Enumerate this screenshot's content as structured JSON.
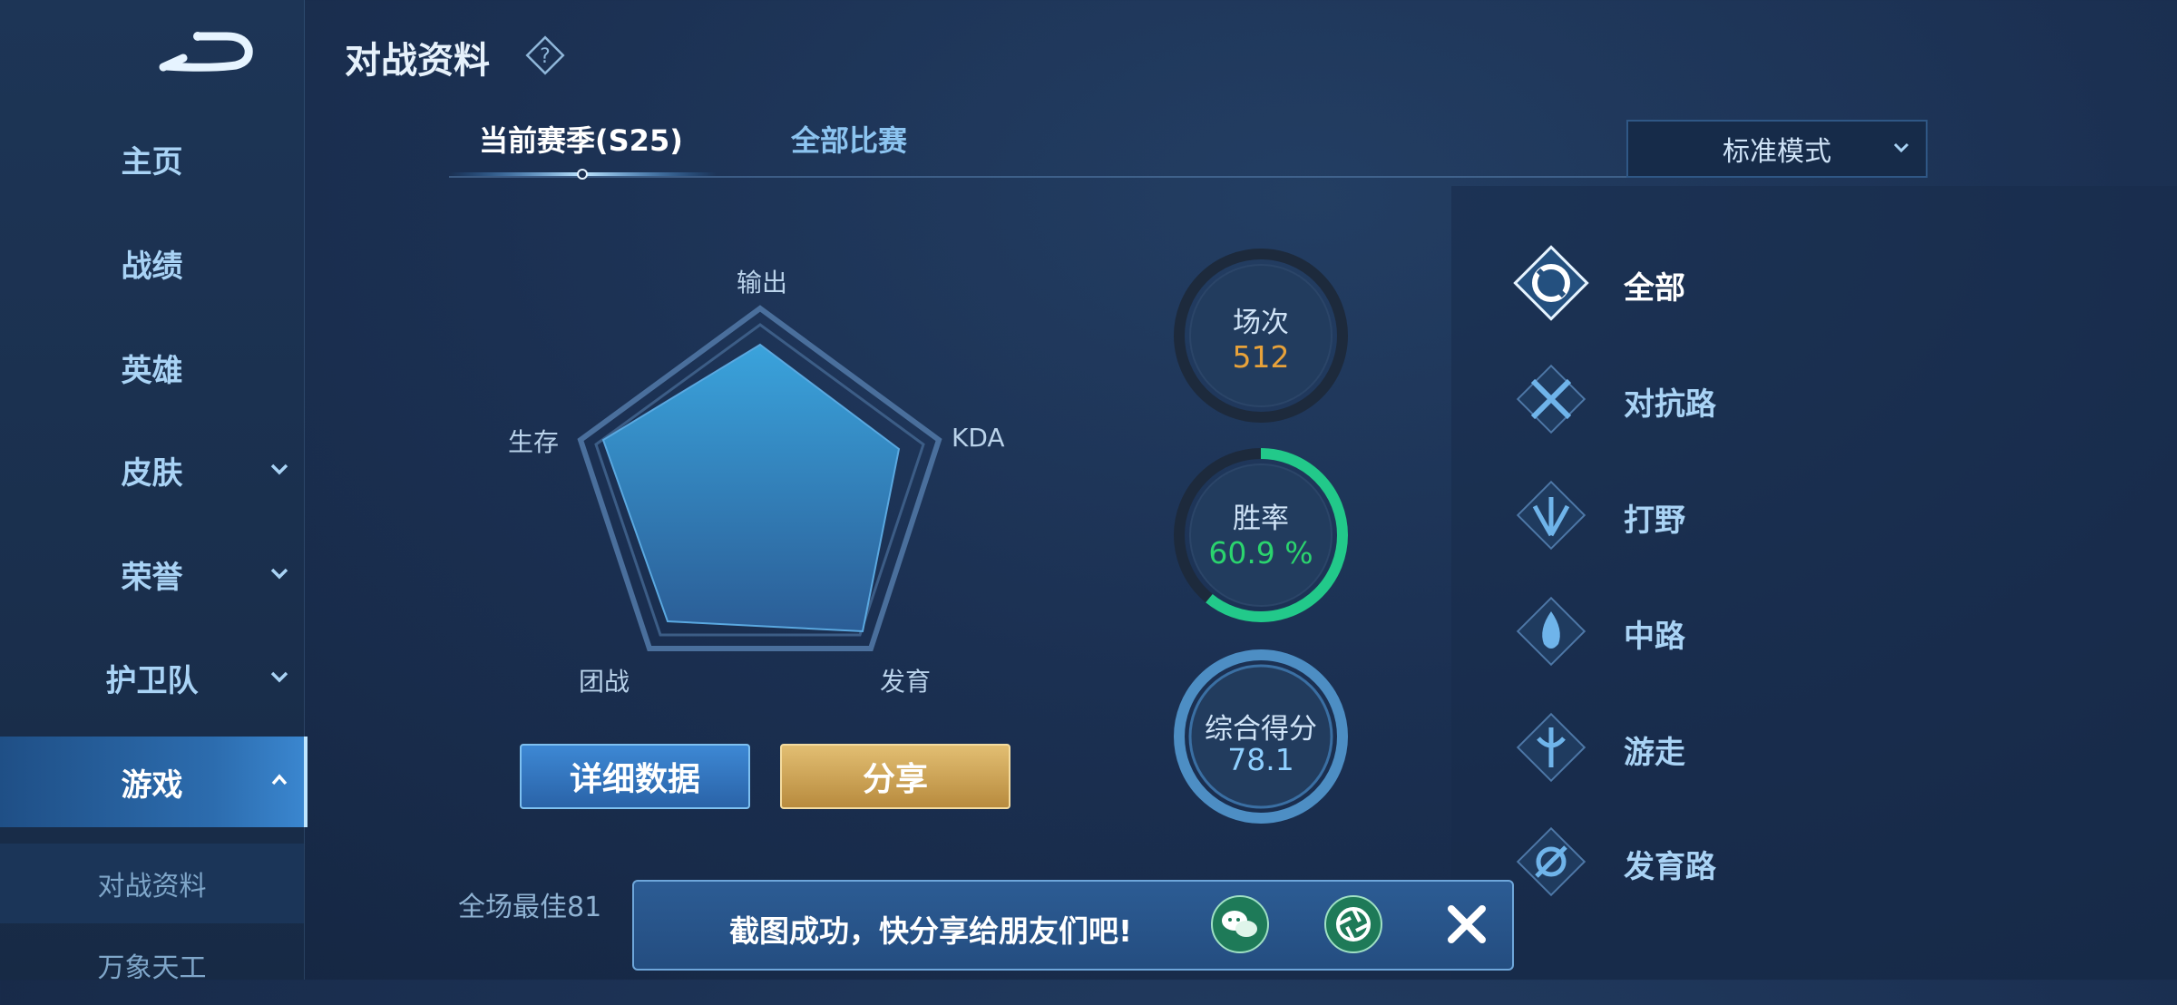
{
  "header": {
    "title": "对战资料"
  },
  "sidebar": {
    "items": [
      {
        "label": "主页"
      },
      {
        "label": "战绩"
      },
      {
        "label": "英雄"
      },
      {
        "label": "皮肤"
      },
      {
        "label": "荣誉"
      },
      {
        "label": "护卫队"
      },
      {
        "label": "游戏"
      }
    ],
    "sub_items": [
      {
        "label": "对战资料"
      },
      {
        "label": "万象天工"
      }
    ]
  },
  "tabs": {
    "current": "当前赛季(S25)",
    "all": "全部比赛"
  },
  "mode_select": {
    "value": "标准模式"
  },
  "radar": {
    "labels": {
      "output": "输出",
      "kda": "KDA",
      "growth": "发育",
      "teamfight": "团战",
      "survival": "生存"
    }
  },
  "buttons": {
    "detail": "详细数据",
    "share": "分享"
  },
  "stats": {
    "matches": {
      "label": "场次",
      "value": "512"
    },
    "winrate": {
      "label": "胜率",
      "value": "60.9 %",
      "fraction": 0.609
    },
    "score": {
      "label": "综合得分",
      "value": "78.1"
    }
  },
  "roles": [
    {
      "label": "全部",
      "icon": "all-icon"
    },
    {
      "label": "对抗路",
      "icon": "clash-lane-icon"
    },
    {
      "label": "打野",
      "icon": "jungle-icon"
    },
    {
      "label": "中路",
      "icon": "mid-lane-icon"
    },
    {
      "label": "游走",
      "icon": "roam-icon"
    },
    {
      "label": "发育路",
      "icon": "farm-lane-icon"
    }
  ],
  "best_text": "全场最佳81",
  "toast": {
    "message": "截图成功，快分享给朋友们吧!"
  },
  "colors": {
    "accent": "#3b8bd6",
    "gold": "#d4a85a",
    "win_green": "#2bd46e",
    "count_orange": "#e8a23a"
  }
}
